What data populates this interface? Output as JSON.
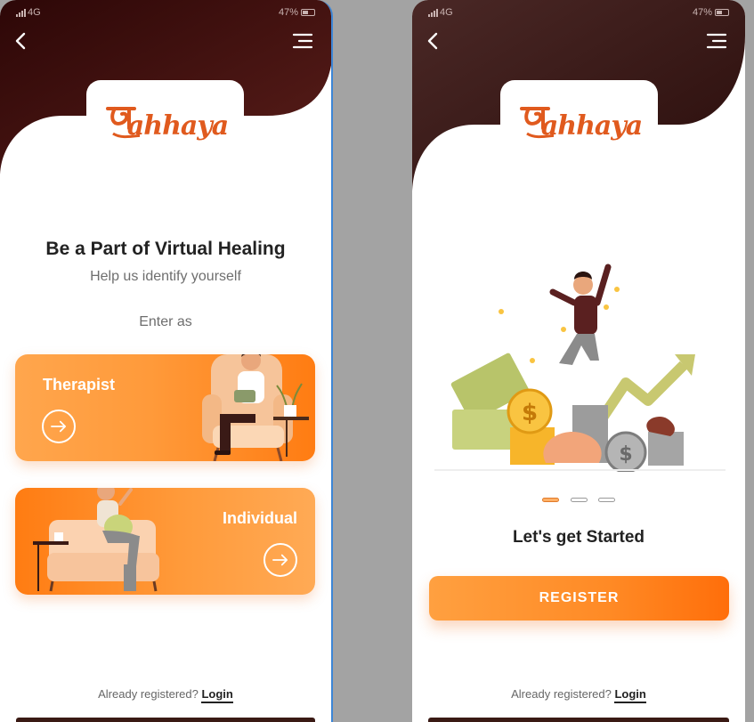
{
  "screens": [
    {
      "status": {
        "carrier": "4G",
        "battery": "47%"
      },
      "logo": "ahhaya",
      "title": "Be a Part of Virtual Healing",
      "subtitle": "Help us identify yourself",
      "enter_as": "Enter as",
      "therapist_label": "Therapist",
      "individual_label": "Individual",
      "already_registered": "Already registered?",
      "login": "Login"
    },
    {
      "status": {
        "carrier": "4G",
        "battery": "47%"
      },
      "logo": "ahhaya",
      "title": "Let's get Started",
      "register": "REGISTER",
      "carousel": {
        "pages": 3,
        "active": 1
      },
      "already_registered": "Already registered?",
      "login": "Login"
    }
  ],
  "colors": {
    "header_dark": "#3d0f0c",
    "accent": "#ff8a25",
    "logo": "#e05a1e"
  },
  "icons": [
    "back-chevron-icon",
    "hamburger-menu-icon",
    "arrow-right-circle-icon",
    "signal-icon",
    "battery-icon"
  ]
}
